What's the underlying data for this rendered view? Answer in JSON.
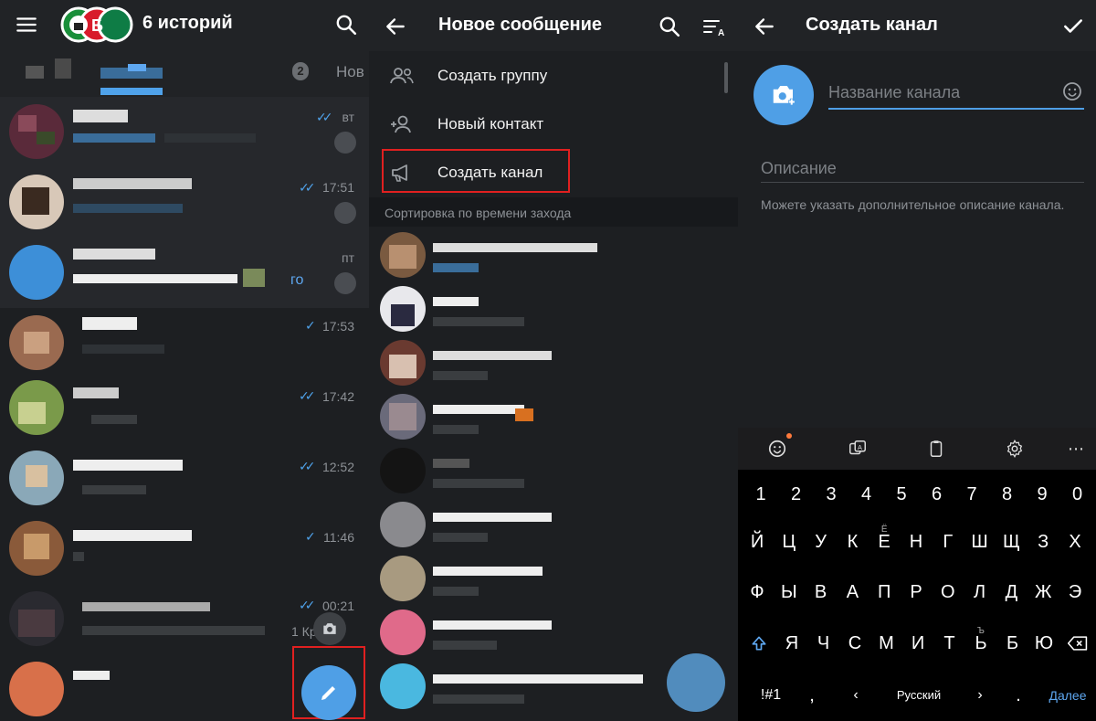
{
  "panel1": {
    "title": "6 историй",
    "tab_count": "2",
    "tab_next": "Нов",
    "chats": [
      {
        "time": "вт",
        "ticks": "double",
        "pinned": true
      },
      {
        "time": "17:51",
        "ticks": "double",
        "pinned": true
      },
      {
        "time": "пт",
        "ticks": "none",
        "pinned": true,
        "preview_tail": "го"
      },
      {
        "time": "17:53",
        "ticks": "single",
        "pinned": false
      },
      {
        "time": "17:42",
        "ticks": "double",
        "pinned": false
      },
      {
        "time": "12:52",
        "ticks": "double",
        "pinned": false
      },
      {
        "time": "11:46",
        "ticks": "single",
        "pinned": false
      },
      {
        "time": "00:21",
        "ticks": "double",
        "pinned": false,
        "preview_tail": "1 Кр"
      },
      {
        "time": "",
        "ticks": "none",
        "pinned": false
      }
    ],
    "icons": [
      "menu-icon",
      "search-icon",
      "pencil-icon",
      "camera-icon"
    ],
    "accent": "#4f9fe6"
  },
  "panel2": {
    "title": "Новое сообщение",
    "menu": [
      {
        "label": "Создать группу",
        "icon": "group-icon"
      },
      {
        "label": "Новый контакт",
        "icon": "add-contact-icon"
      },
      {
        "label": "Создать канал",
        "icon": "megaphone-icon"
      }
    ],
    "section_label": "Сортировка по времени захода"
  },
  "panel3": {
    "title": "Создать канал",
    "name_placeholder": "Название канала",
    "description_placeholder": "Описание",
    "hint": "Можете указать дополнительное описание канала.",
    "keyboard": {
      "row_numbers": [
        "1",
        "2",
        "3",
        "4",
        "5",
        "6",
        "7",
        "8",
        "9",
        "0"
      ],
      "row1": [
        "Й",
        "Ц",
        "У",
        "К",
        "Е",
        "Н",
        "Г",
        "Ш",
        "Щ",
        "З",
        "Х"
      ],
      "row1_alt": {
        "Е": "Ё"
      },
      "row2": [
        "Ф",
        "Ы",
        "В",
        "А",
        "П",
        "Р",
        "О",
        "Л",
        "Д",
        "Ж",
        "Э"
      ],
      "row3": [
        "Я",
        "Ч",
        "С",
        "М",
        "И",
        "Т",
        "Ь",
        "Б",
        "Ю"
      ],
      "row3_alt": {
        "Ь": "Ъ"
      },
      "symbols_label": "!#1",
      "comma_label": ",",
      "language_label": "Русский",
      "period_label": ".",
      "done_label": "Далее"
    }
  }
}
